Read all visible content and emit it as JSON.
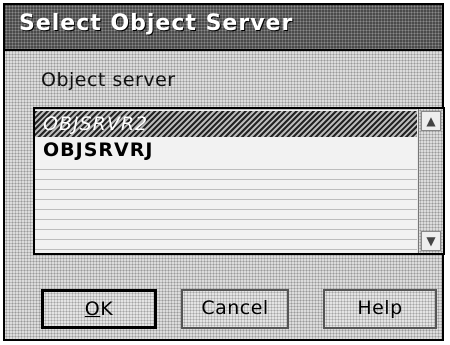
{
  "dialog": {
    "title": "Select Object Server",
    "list_label": "Object server",
    "items": [
      "OBJSRVR2",
      "OBJSRVRJ"
    ],
    "selected_index": 0,
    "buttons": {
      "ok_mnemonic": "O",
      "ok_rest": "K",
      "cancel": "Cancel",
      "help": "Help"
    }
  }
}
